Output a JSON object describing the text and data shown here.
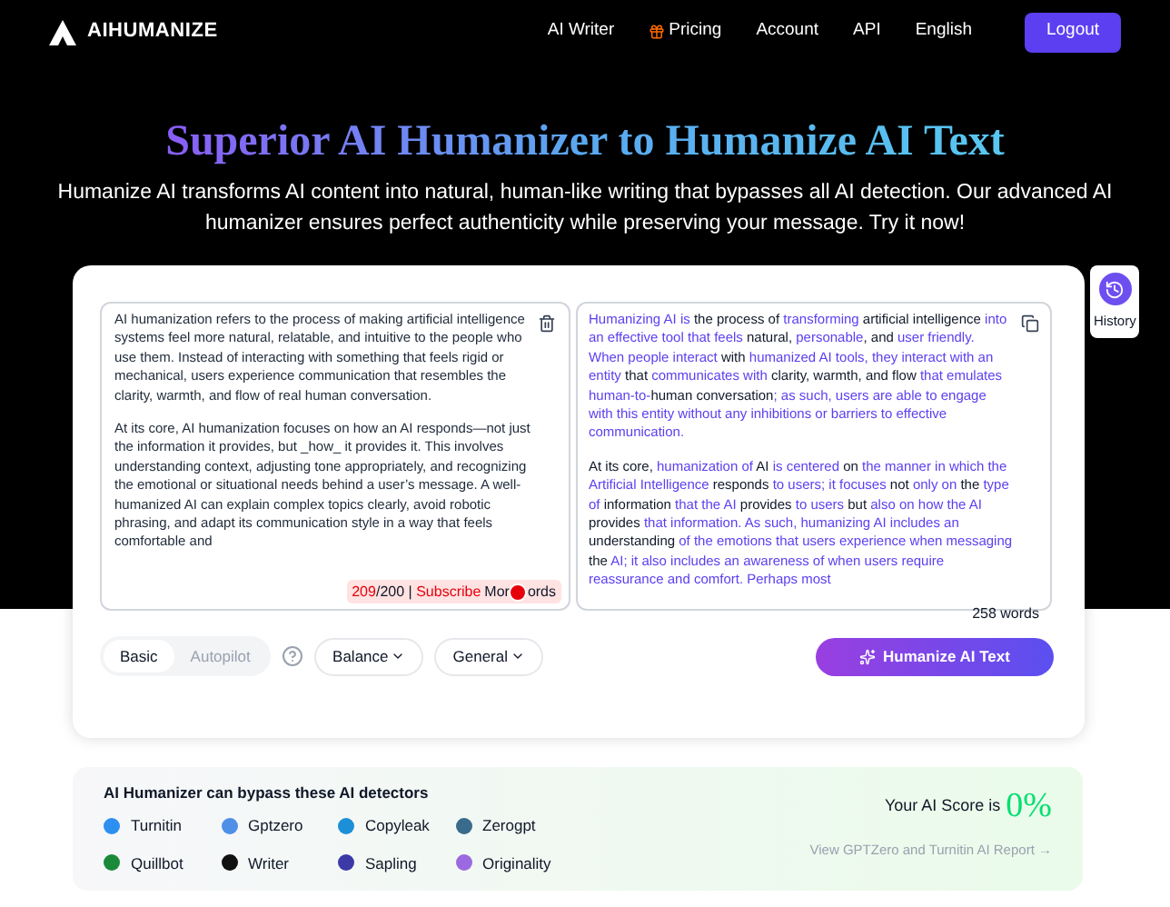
{
  "nav": {
    "brand": "AIHUMANIZE",
    "links": [
      {
        "label": "AI Writer",
        "kind": "text"
      },
      {
        "label": "Pricing",
        "kind": "gift"
      },
      {
        "label": "Account",
        "kind": "text"
      },
      {
        "label": "API",
        "kind": "text"
      },
      {
        "label": "English",
        "kind": "text"
      }
    ],
    "logout": "Logout"
  },
  "hero": {
    "title": "Superior AI Humanizer to Humanize AI Text",
    "subtitle": "Humanize AI transforms AI content into natural, human-like writing that bypasses all AI detection. Our advanced AI humanizer ensures perfect authenticity while preserving your message. Try it now!"
  },
  "history": "History",
  "input": {
    "paragraphs": [
      "AI humanization refers to the process of making artificial intelligence systems feel more natural, relatable, and intuitive to the people who use them. Instead of interacting with something that feels rigid or mechanical, users experience communication that resembles the clarity, warmth, and flow of real human conversation.",
      "At its core, AI humanization focuses on how an AI responds—not just the information it provides, but _how_ it provides it. This involves understanding context, adjusting tone appropriately, and recognizing the emotional or situational needs behind a user’s message. A well-humanized AI can explain complex topics clearly, avoid robotic phrasing, and adapt its communication style in a way that feels comfortable and"
    ],
    "count": "209",
    "limit": "/200 |",
    "subscribe": "Subscribe",
    "more_a": "Mor",
    "more_b": "ords"
  },
  "output": {
    "paragraphs": [
      [
        {
          "t": "Humanizing AI is",
          "changed": true
        },
        {
          "t": " the process of ",
          "changed": false
        },
        {
          "t": "transforming",
          "changed": true
        },
        {
          "t": " artificial intelligence ",
          "changed": false
        },
        {
          "t": "into an effective tool that feels",
          "changed": true
        },
        {
          "t": " natural, ",
          "changed": false
        },
        {
          "t": "personable",
          "changed": true
        },
        {
          "t": ", and ",
          "changed": false
        },
        {
          "t": "user friendly. When people interact",
          "changed": true
        },
        {
          "t": " with ",
          "changed": false
        },
        {
          "t": "humanized AI tools, they interact with an entity",
          "changed": true
        },
        {
          "t": " that ",
          "changed": false
        },
        {
          "t": "communicates with",
          "changed": true
        },
        {
          "t": " clarity, warmth, and flow ",
          "changed": false
        },
        {
          "t": "that emulates human-to-",
          "changed": true
        },
        {
          "t": "human conversation",
          "changed": false
        },
        {
          "t": "; as such, users are able to engage with this entity without any inhibitions or barriers to effective communication.",
          "changed": true
        }
      ],
      [
        {
          "t": "At its core, ",
          "changed": false
        },
        {
          "t": "humanization of",
          "changed": true
        },
        {
          "t": " AI ",
          "changed": false
        },
        {
          "t": "is centered",
          "changed": true
        },
        {
          "t": " on ",
          "changed": false
        },
        {
          "t": "the manner in which the Artificial Intelligence",
          "changed": true
        },
        {
          "t": " responds ",
          "changed": false
        },
        {
          "t": "to users; it focuses",
          "changed": true
        },
        {
          "t": " not ",
          "changed": false
        },
        {
          "t": "only on",
          "changed": true
        },
        {
          "t": " the ",
          "changed": false
        },
        {
          "t": "type of",
          "changed": true
        },
        {
          "t": " information ",
          "changed": false
        },
        {
          "t": "that the AI",
          "changed": true
        },
        {
          "t": " provides ",
          "changed": false
        },
        {
          "t": "to users",
          "changed": true
        },
        {
          "t": " but ",
          "changed": false
        },
        {
          "t": "also on how the AI",
          "changed": true
        },
        {
          "t": " provides ",
          "changed": false
        },
        {
          "t": "that information. As such, humanizing AI includes an",
          "changed": true
        },
        {
          "t": " understanding ",
          "changed": false
        },
        {
          "t": "of the emotions that users experience when messaging",
          "changed": true
        },
        {
          "t": " the ",
          "changed": false
        },
        {
          "t": "AI; it also includes an awareness of when users require reassurance and comfort. Perhaps most",
          "changed": true
        }
      ]
    ],
    "words": "258 words"
  },
  "modes": [
    {
      "label": "Basic",
      "selected": true
    },
    {
      "label": "Autopilot",
      "selected": false
    }
  ],
  "dropdowns": [
    "Balance",
    "General"
  ],
  "humanize": "Humanize AI Text",
  "detectors": {
    "title": "AI Humanizer can bypass these AI detectors",
    "items": [
      {
        "name": "Turnitin",
        "color": "#2d8ff0"
      },
      {
        "name": "Gptzero",
        "color": "#4f8fe8"
      },
      {
        "name": "Copyleak",
        "color": "#1c8fd8"
      },
      {
        "name": "Zerogpt",
        "color": "#3a6b8c"
      },
      {
        "name": "Quillbot",
        "color": "#1a8a3a"
      },
      {
        "name": "Writer",
        "color": "#111111"
      },
      {
        "name": "Sapling",
        "color": "#3b3aa8"
      },
      {
        "name": "Originality",
        "color": "#9b6ae0"
      }
    ],
    "score_label": "Your AI Score is",
    "score": "0%",
    "report": "View GPTZero and Turnitin AI Report →"
  }
}
